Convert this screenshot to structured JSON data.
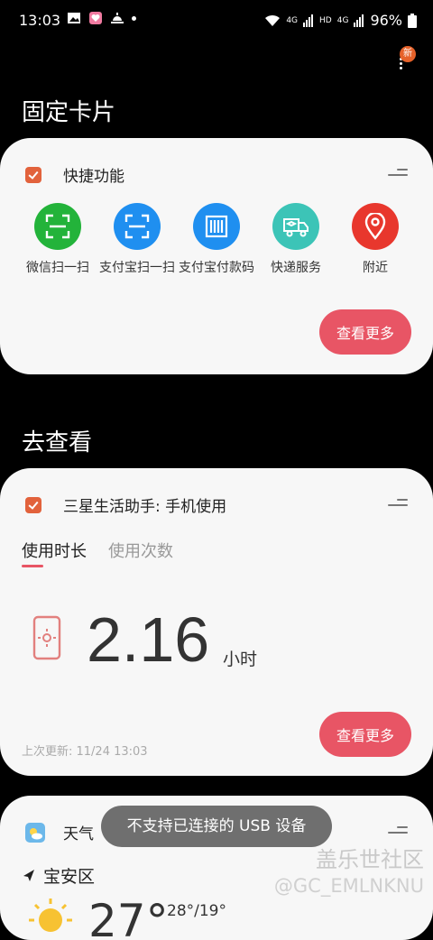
{
  "status_bar": {
    "time": "13:03",
    "net_label": "4G",
    "hd_label": "HD",
    "net_label2": "4G",
    "battery": "96%"
  },
  "menu": {
    "badge": "新"
  },
  "pinned": {
    "title": "固定卡片",
    "card_title": "快捷功能",
    "shortcuts": [
      {
        "label": "微信扫一扫",
        "color": "#23b33a",
        "icon": "scan-icon"
      },
      {
        "label": "支付宝扫一扫",
        "color": "#1f8ff0",
        "icon": "scan-icon"
      },
      {
        "label": "支付宝付款码",
        "color": "#1f8ff0",
        "icon": "barcode-icon"
      },
      {
        "label": "快递服务",
        "color": "#3cc4b7",
        "icon": "truck-icon"
      },
      {
        "label": "附近",
        "color": "#e8372d",
        "icon": "location-pin-icon"
      }
    ],
    "more_label": "查看更多"
  },
  "view": {
    "title": "去查看",
    "card_title": "三星生活助手: 手机使用",
    "tabs": [
      "使用时长",
      "使用次数"
    ],
    "value": "2.16",
    "unit": "小时",
    "updated": "上次更新:  11/24 13:03",
    "more_label": "查看更多"
  },
  "weather": {
    "card_title": "天气",
    "location": "宝安区",
    "temp": "27°",
    "range": "28°/19°"
  },
  "toast": "不支持已连接的 USB 设备",
  "watermark": {
    "brand": "盖乐世社区",
    "handle": "@GC_EMLNKNU"
  }
}
